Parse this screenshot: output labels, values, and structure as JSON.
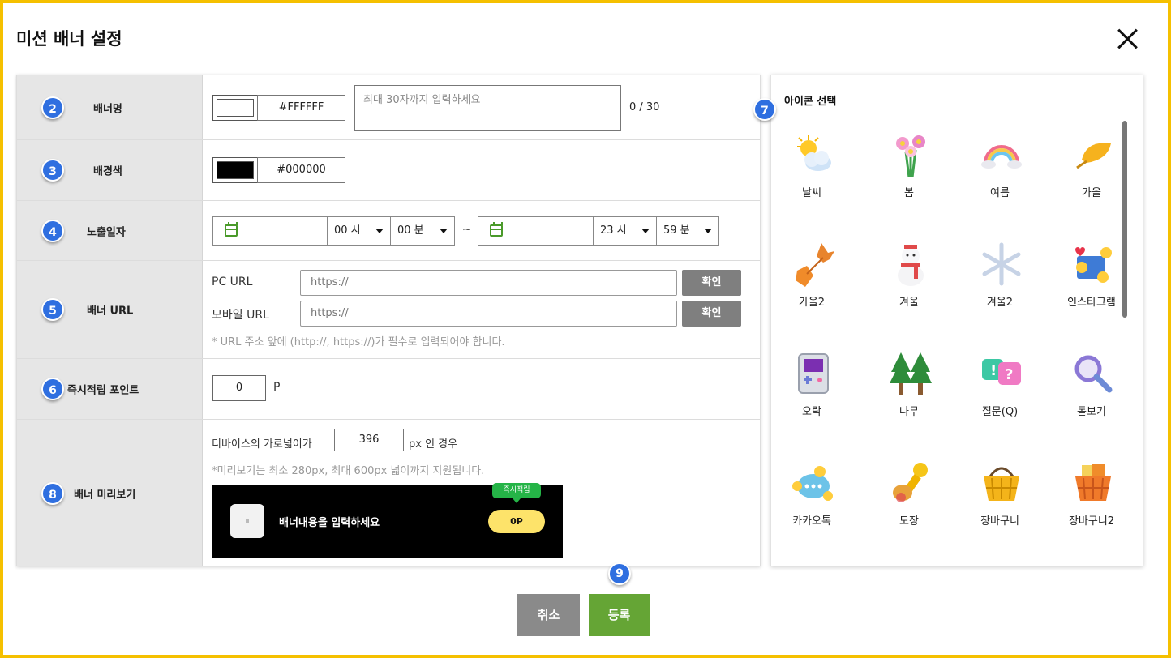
{
  "dialog": {
    "title": "미션 배너 설정"
  },
  "rows": {
    "banner_name": {
      "badge": "2",
      "label": "배너명",
      "text_color_hex": "#FFFFFF",
      "text_placeholder": "최대 30자까지 입력하세요",
      "counter": "0 / 30"
    },
    "bg_color": {
      "badge": "3",
      "label": "배경색",
      "hex": "#000000"
    },
    "display_date": {
      "badge": "4",
      "label": "노출일자",
      "start_hour": "00 시",
      "start_minute": "00 분",
      "separator": "~",
      "end_hour": "23 시",
      "end_minute": "59 분"
    },
    "banner_url": {
      "badge": "5",
      "label": "배너 URL",
      "pc_label": "PC URL",
      "pc_value": "https://",
      "mobile_label": "모바일 URL",
      "mobile_value": "https://",
      "confirm_label": "확인",
      "note": "* URL 주소 앞에 (http://, https://)가 필수로 입력되어야 합니다."
    },
    "instant_points": {
      "badge": "6",
      "label": "즉시적립 포인트",
      "value": "0",
      "unit": "P"
    },
    "preview": {
      "badge": "8",
      "label": "배너 미리보기",
      "width_prefix": "디바이스의 가로넓이가",
      "width_value": "396",
      "width_suffix": "px 인 경우",
      "note": "*미리보기는 최소 280px, 최대 600px 넓이까지 지원됩니다.",
      "banner_text": "배너내용을 입력하세요",
      "banner_points": "0P",
      "banner_tag": "즉시적립"
    }
  },
  "icon_panel": {
    "badge": "7",
    "title": "아이콘 선택",
    "icons": [
      {
        "name": "weather",
        "label": "날씨"
      },
      {
        "name": "spring",
        "label": "봄"
      },
      {
        "name": "summer",
        "label": "여름"
      },
      {
        "name": "autumn",
        "label": "가을"
      },
      {
        "name": "autumn2",
        "label": "가을2"
      },
      {
        "name": "winter",
        "label": "겨울"
      },
      {
        "name": "winter2",
        "label": "겨울2"
      },
      {
        "name": "instagram",
        "label": "인스타그램"
      },
      {
        "name": "game",
        "label": "오락"
      },
      {
        "name": "tree",
        "label": "나무"
      },
      {
        "name": "question",
        "label": "질문(Q)"
      },
      {
        "name": "magnifier",
        "label": "돋보기"
      },
      {
        "name": "kakaotalk",
        "label": "카카오톡"
      },
      {
        "name": "stamp",
        "label": "도장"
      },
      {
        "name": "basket",
        "label": "장바구니"
      },
      {
        "name": "basket2",
        "label": "장바구니2"
      }
    ]
  },
  "footer": {
    "badge": "9",
    "cancel_label": "취소",
    "submit_label": "등록"
  },
  "colors": {
    "frame": "#f5c000",
    "badge": "#2f6fe0",
    "submit": "#65a535",
    "cancel": "#8a8a8a",
    "confirm": "#7f7f7f"
  }
}
